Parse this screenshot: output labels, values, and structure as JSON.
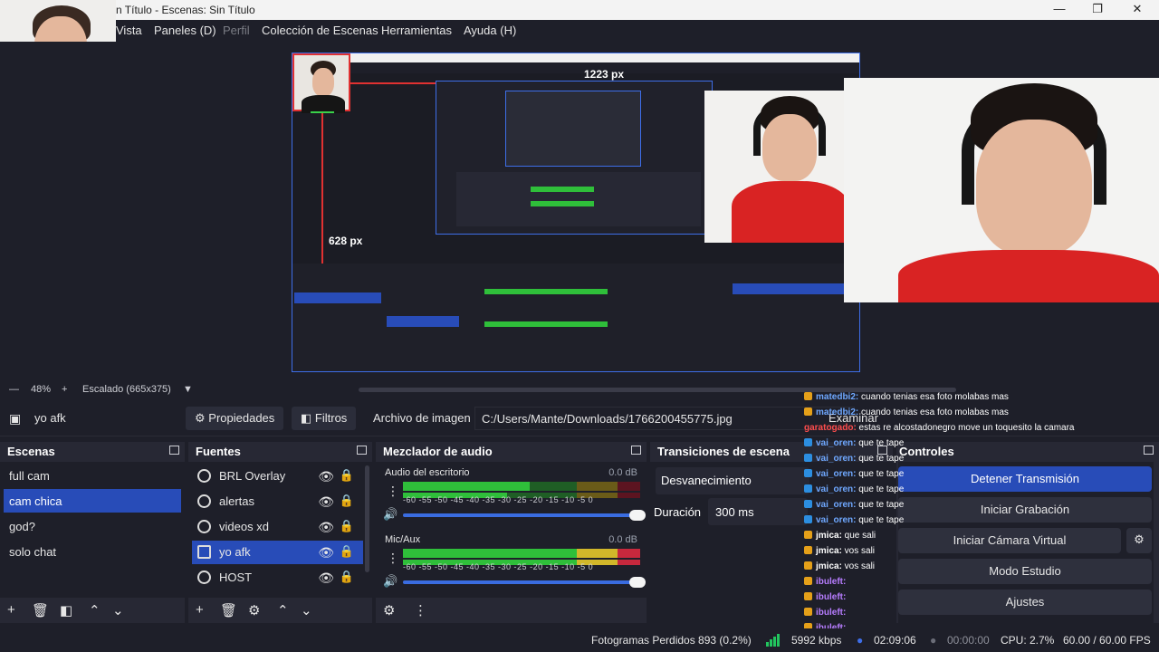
{
  "window": {
    "title": "n Título - Escenas: Sin Título",
    "minimize": "—",
    "maximize": "❐",
    "close": "✕"
  },
  "menu": {
    "items": [
      {
        "label": "Vista",
        "disabled": false
      },
      {
        "label": "Paneles (D)",
        "disabled": false
      },
      {
        "label": "Perfil",
        "disabled": true
      },
      {
        "label": "Colección de Escenas",
        "disabled": false
      },
      {
        "label": "Herramientas",
        "disabled": false
      },
      {
        "label": "Ayuda (H)",
        "disabled": false
      }
    ]
  },
  "preview": {
    "top_measure": "1223 px",
    "left_measure": "628 px",
    "nested": {
      "scenes": [
        "full cam",
        "cam chica",
        "god?",
        "solo chat"
      ],
      "sources": [
        "BRL Overlay",
        "alertas",
        "videos xd",
        "yo afk",
        "HOST"
      ],
      "status": "Fotogramas Perdidos 893 (0.2%)"
    }
  },
  "zoom": {
    "minus": "—",
    "percent": "48%",
    "plus": "+",
    "scaled": "Escalado (665x375)",
    "dropdown": "▼"
  },
  "source_toolbar": {
    "source_name": "yo afk",
    "properties": "Propiedades",
    "filters": "Filtros",
    "image_file_label": "Archivo de imagen",
    "path": "C:/Users/Mante/Downloads/1766200455775.jpg",
    "browse": "Examinar"
  },
  "scenes": {
    "title": "Escenas",
    "items": [
      {
        "label": "full cam",
        "selected": false
      },
      {
        "label": "cam chica",
        "selected": true
      },
      {
        "label": "god?",
        "selected": false
      },
      {
        "label": "solo chat",
        "selected": false
      }
    ]
  },
  "sources": {
    "title": "Fuentes",
    "items": [
      {
        "label": "BRL Overlay",
        "selected": false
      },
      {
        "label": "alertas",
        "selected": false
      },
      {
        "label": "videos xd",
        "selected": false
      },
      {
        "label": "yo afk",
        "selected": true
      },
      {
        "label": "HOST",
        "selected": false
      }
    ]
  },
  "mixer": {
    "title": "Mezclador de audio",
    "channels": [
      {
        "name": "Audio del escritorio",
        "db": "0.0 dB"
      },
      {
        "name": "Mic/Aux",
        "db": "0.0 dB"
      }
    ],
    "ticks": "-60 -55 -50 -45 -40 -35 -30 -25 -20 -15 -10 -5 0"
  },
  "transitions": {
    "title": "Transiciones de escena",
    "type": "Desvanecimiento",
    "duration_label": "Duración",
    "duration_value": "300 ms"
  },
  "controls": {
    "title": "Controles",
    "stop_stream": "Detener Transmisión",
    "start_recording": "Iniciar Grabación",
    "virtual_cam": "Iniciar Cámara Virtual",
    "studio_mode": "Modo Estudio",
    "settings": "Ajustes"
  },
  "chat": [
    {
      "user": "matedbi2:",
      "msg": " cuando tenias esa foto molabas mas",
      "color": "#6fa8ff",
      "badge": "gold"
    },
    {
      "user": "matedbi2:",
      "msg": " cuando tenias esa foto molabas mas",
      "color": "#6fa8ff",
      "badge": "gold"
    },
    {
      "user": "garatogado:",
      "msg": " estas re alcostadonegro move un toquesito la camara",
      "color": "#ff4d4d",
      "badge": "none"
    },
    {
      "user": "vai_oren:",
      "msg": " que te tape",
      "color": "#6fa8ff",
      "badge": "blue"
    },
    {
      "user": "vai_oren:",
      "msg": " que te tape",
      "color": "#6fa8ff",
      "badge": "blue"
    },
    {
      "user": "vai_oren:",
      "msg": " que te tape",
      "color": "#6fa8ff",
      "badge": "blue"
    },
    {
      "user": "vai_oren:",
      "msg": " que te tape",
      "color": "#6fa8ff",
      "badge": "blue"
    },
    {
      "user": "vai_oren:",
      "msg": " que te tape",
      "color": "#6fa8ff",
      "badge": "blue"
    },
    {
      "user": "vai_oren:",
      "msg": " que te tape",
      "color": "#6fa8ff",
      "badge": "blue"
    },
    {
      "user": "jmica:",
      "msg": " que sali",
      "color": "#ffffff",
      "badge": "gold"
    },
    {
      "user": "jmica:",
      "msg": " vos sali",
      "color": "#ffffff",
      "badge": "gold"
    },
    {
      "user": "jmica:",
      "msg": " vos sali",
      "color": "#ffffff",
      "badge": "gold"
    },
    {
      "user": "ibuleft:",
      "msg": "",
      "color": "#b77dff",
      "badge": "gold"
    },
    {
      "user": "ibuleft:",
      "msg": "",
      "color": "#b77dff",
      "badge": "gold"
    },
    {
      "user": "ibuleft:",
      "msg": "",
      "color": "#b77dff",
      "badge": "gold"
    },
    {
      "user": "ibuleft:",
      "msg": "",
      "color": "#b77dff",
      "badge": "gold"
    }
  ],
  "status": {
    "dropped": "Fotogramas Perdidos 893 (0.2%)",
    "bitrate": "5992 kbps",
    "live_time": "02:09:06",
    "rec_time": "00:00:00",
    "cpu": "CPU: 2.7%",
    "fps": "60.00 / 60.00 FPS"
  },
  "colors": {
    "accent": "#284cb8",
    "panel": "#272834",
    "bg": "#1e1f29",
    "meter_green": "#2fbf3a",
    "meter_yellow": "#d2b72a",
    "meter_red": "#c7283d"
  }
}
